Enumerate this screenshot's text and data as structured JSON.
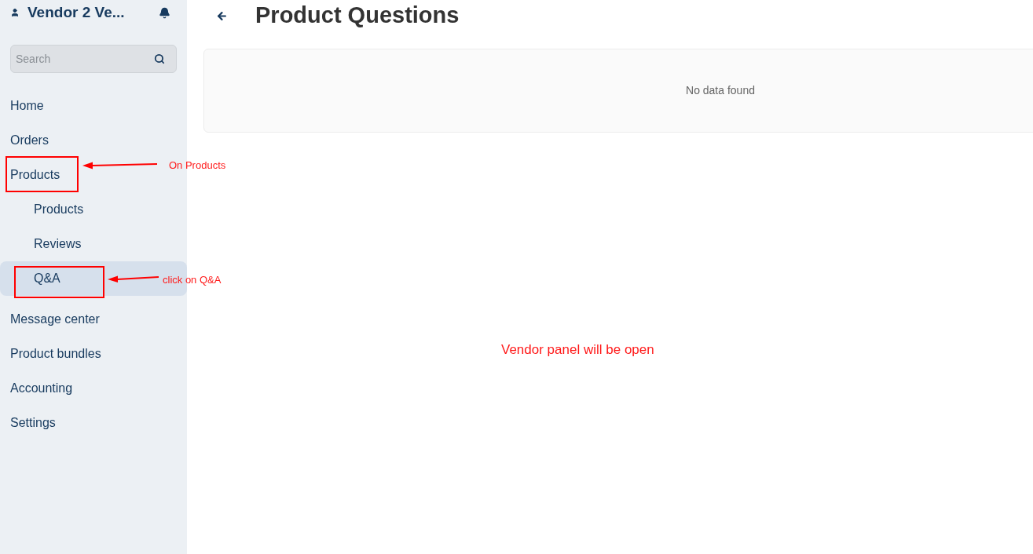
{
  "sidebar": {
    "account_name": "Vendor 2 Ve...",
    "search": {
      "placeholder": "Search"
    },
    "items": [
      {
        "label": "Home",
        "selected": false
      },
      {
        "label": "Orders",
        "selected": false
      },
      {
        "label": "Products",
        "selected": false,
        "callout": "On Products",
        "children": [
          {
            "label": "Products",
            "selected": false
          },
          {
            "label": "Reviews",
            "selected": false
          },
          {
            "label": "Q&A",
            "selected": true,
            "callout": "click on Q&A"
          }
        ]
      },
      {
        "label": "Message center",
        "selected": false
      },
      {
        "label": "Product bundles",
        "selected": false
      },
      {
        "label": "Accounting",
        "selected": false
      },
      {
        "label": "Settings",
        "selected": false
      }
    ]
  },
  "page": {
    "title": "Product Questions",
    "empty_message": "No data found",
    "note": "Vendor panel will be open"
  }
}
